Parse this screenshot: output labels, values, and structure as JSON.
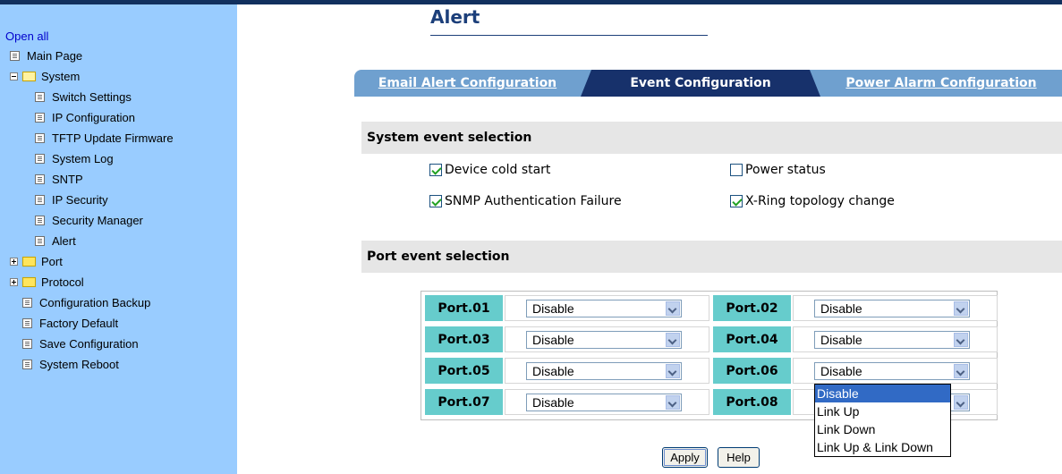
{
  "sidebar": {
    "open_all": "Open all",
    "items": [
      {
        "label": "Main Page",
        "icon": "page-icon"
      },
      {
        "label": "System",
        "icon": "folder-open-icon",
        "toggle": "minus"
      },
      {
        "label": "Switch Settings",
        "icon": "page-icon"
      },
      {
        "label": "IP Configuration",
        "icon": "page-icon"
      },
      {
        "label": "TFTP Update Firmware",
        "icon": "page-icon"
      },
      {
        "label": "System Log",
        "icon": "page-icon"
      },
      {
        "label": "SNTP",
        "icon": "page-icon"
      },
      {
        "label": "IP Security",
        "icon": "page-icon"
      },
      {
        "label": "Security Manager",
        "icon": "page-icon"
      },
      {
        "label": "Alert",
        "icon": "page-icon"
      },
      {
        "label": "Port",
        "icon": "folder-icon",
        "toggle": "plus"
      },
      {
        "label": "Protocol",
        "icon": "folder-icon",
        "toggle": "plus"
      },
      {
        "label": "Configuration Backup",
        "icon": "page-icon"
      },
      {
        "label": "Factory Default",
        "icon": "page-icon"
      },
      {
        "label": "Save Configuration",
        "icon": "page-icon"
      },
      {
        "label": "System Reboot",
        "icon": "page-icon"
      }
    ]
  },
  "main": {
    "title": "Alert",
    "tabs": [
      {
        "label": "Email Alert Configuration",
        "active": false
      },
      {
        "label": "Event Configuration",
        "active": true
      },
      {
        "label": "Power Alarm Configuration",
        "active": false
      }
    ],
    "system_section": {
      "title": "System event selection",
      "events": [
        {
          "label": "Device cold start",
          "checked": true
        },
        {
          "label": "Power status",
          "checked": false
        },
        {
          "label": "SNMP Authentication Failure",
          "checked": true
        },
        {
          "label": "X-Ring topology change",
          "checked": true
        }
      ]
    },
    "port_section": {
      "title": "Port event selection",
      "ports": [
        {
          "label": "Port.01",
          "value": "Disable"
        },
        {
          "label": "Port.02",
          "value": "Disable"
        },
        {
          "label": "Port.03",
          "value": "Disable"
        },
        {
          "label": "Port.04",
          "value": "Disable"
        },
        {
          "label": "Port.05",
          "value": "Disable"
        },
        {
          "label": "Port.06",
          "value": "Disable"
        },
        {
          "label": "Port.07",
          "value": "Disable"
        },
        {
          "label": "Port.08",
          "value": ""
        }
      ]
    },
    "dropdown_options": [
      "Disable",
      "Link Up",
      "Link Down",
      "Link Up & Link Down"
    ],
    "dropdown_selected": "Disable",
    "buttons": {
      "apply": "Apply",
      "help": "Help"
    }
  },
  "colors": {
    "sidebar_bg": "#99ccff",
    "tab_active": "#17316b",
    "tab_inactive": "#6fa0cf",
    "port_label_bg": "#66cccc",
    "title": "#1c3f7a"
  }
}
